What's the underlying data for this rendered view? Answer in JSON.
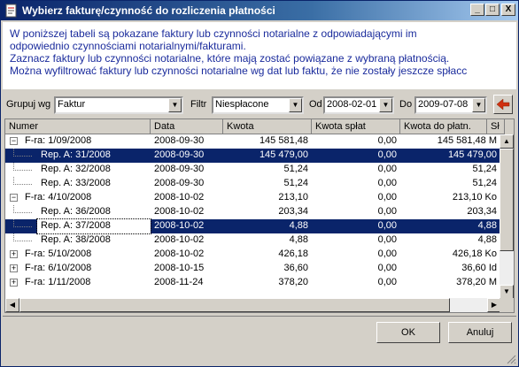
{
  "window": {
    "title": "Wybierz fakturę/czynność do rozliczenia płatności",
    "controls": {
      "minimize": "_",
      "maximize": "□",
      "close": "X"
    }
  },
  "info": {
    "lines": [
      "W poniższej tabeli są pokazane faktury lub czynności notarialne z odpowiadającymi im",
      "odpowiednio czynnościami notarialnymi/fakturami.",
      "Zaznacz faktury lub czynności notarialne, które mają zostać powiązane z wybraną płatnością.",
      "Można wyfiltrować faktury lub czynności notarialne wg dat lub faktu, że nie zostały jeszcze spłacc"
    ]
  },
  "filters": {
    "group_label": "Grupuj wg",
    "group_value": "Faktur",
    "filter_label": "Filtr",
    "filter_value": "Niespłacone",
    "from_label": "Od",
    "from_value": "2008-02-01",
    "to_label": "Do",
    "to_value": "2009-07-08"
  },
  "grid": {
    "columns": [
      "Numer",
      "Data",
      "Kwota",
      "Kwota spłat",
      "Kwota do płatn.",
      "Sł"
    ],
    "rows": [
      {
        "level": 0,
        "expander": "−",
        "numer": "F-ra: 1/09/2008",
        "data": "2008-09-30",
        "kwota": "145 581,48",
        "splat": "0,00",
        "do_platn": "145 581,48 M",
        "state": ""
      },
      {
        "level": 1,
        "expander": "",
        "numer": "Rep. A: 31/2008",
        "data": "2008-09-30",
        "kwota": "145 479,00",
        "splat": "0,00",
        "do_platn": "145 479,00",
        "state": "sel"
      },
      {
        "level": 1,
        "expander": "",
        "numer": "Rep. A: 32/2008",
        "data": "2008-09-30",
        "kwota": "51,24",
        "splat": "0,00",
        "do_platn": "51,24",
        "state": ""
      },
      {
        "level": 1,
        "expander": "",
        "numer": "Rep. A: 33/2008",
        "data": "2008-09-30",
        "kwota": "51,24",
        "splat": "0,00",
        "do_platn": "51,24",
        "state": ""
      },
      {
        "level": 0,
        "expander": "−",
        "numer": "F-ra: 4/10/2008",
        "data": "2008-10-02",
        "kwota": "213,10",
        "splat": "0,00",
        "do_platn": "213,10 Ko",
        "state": ""
      },
      {
        "level": 1,
        "expander": "",
        "numer": "Rep. A: 36/2008",
        "data": "2008-10-02",
        "kwota": "203,34",
        "splat": "0,00",
        "do_platn": "203,34",
        "state": ""
      },
      {
        "level": 1,
        "expander": "",
        "numer": "Rep. A: 37/2008",
        "data": "2008-10-02",
        "kwota": "4,88",
        "splat": "0,00",
        "do_platn": "4,88",
        "state": "focus"
      },
      {
        "level": 1,
        "expander": "",
        "numer": "Rep. A: 38/2008",
        "data": "2008-10-02",
        "kwota": "4,88",
        "splat": "0,00",
        "do_platn": "4,88",
        "state": ""
      },
      {
        "level": 0,
        "expander": "+",
        "numer": "F-ra: 5/10/2008",
        "data": "2008-10-02",
        "kwota": "426,18",
        "splat": "0,00",
        "do_platn": "426,18 Ko",
        "state": ""
      },
      {
        "level": 0,
        "expander": "+",
        "numer": "F-ra: 6/10/2008",
        "data": "2008-10-15",
        "kwota": "36,60",
        "splat": "0,00",
        "do_platn": "36,60 Id",
        "state": ""
      },
      {
        "level": 0,
        "expander": "+",
        "numer": "F-ra: 1/11/2008",
        "data": "2008-11-24",
        "kwota": "378,20",
        "splat": "0,00",
        "do_platn": "378,20 M",
        "state": ""
      }
    ]
  },
  "buttons": {
    "ok": "OK",
    "cancel": "Anuluj"
  },
  "colors": {
    "selection": "#0a246a",
    "info_text": "#1a2b9c",
    "back_arrow": "#d03010"
  }
}
